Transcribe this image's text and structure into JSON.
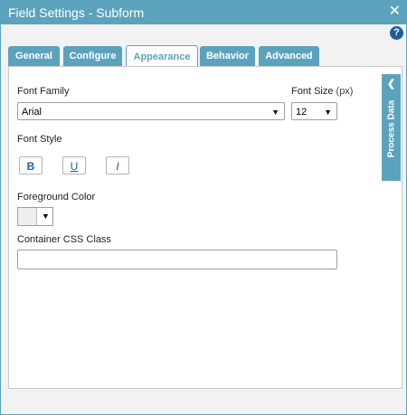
{
  "window": {
    "title": "Field Settings - Subform",
    "close_glyph": "✕",
    "help_glyph": "?"
  },
  "tabs": [
    {
      "label": "General"
    },
    {
      "label": "Configure"
    },
    {
      "label": "Appearance",
      "active": true
    },
    {
      "label": "Behavior"
    },
    {
      "label": "Advanced"
    }
  ],
  "form": {
    "font_family": {
      "label": "Font Family",
      "value": "Arial"
    },
    "font_size": {
      "label": "Font Size",
      "unit": "(px)",
      "value": "12"
    },
    "font_style": {
      "label": "Font Style",
      "bold": "B",
      "underline": "U",
      "italic": "I"
    },
    "foreground_color": {
      "label": "Foreground Color"
    },
    "container_css_class": {
      "label": "Container CSS Class",
      "value": ""
    }
  },
  "side_panel": {
    "label": "Process Data",
    "chevron": "❮"
  },
  "colors": {
    "accent": "#5ba3bd",
    "help": "#1f5e9e"
  },
  "icons": [
    "close-icon",
    "help-icon",
    "dropdown-caret-icon",
    "chevron-left-icon"
  ]
}
